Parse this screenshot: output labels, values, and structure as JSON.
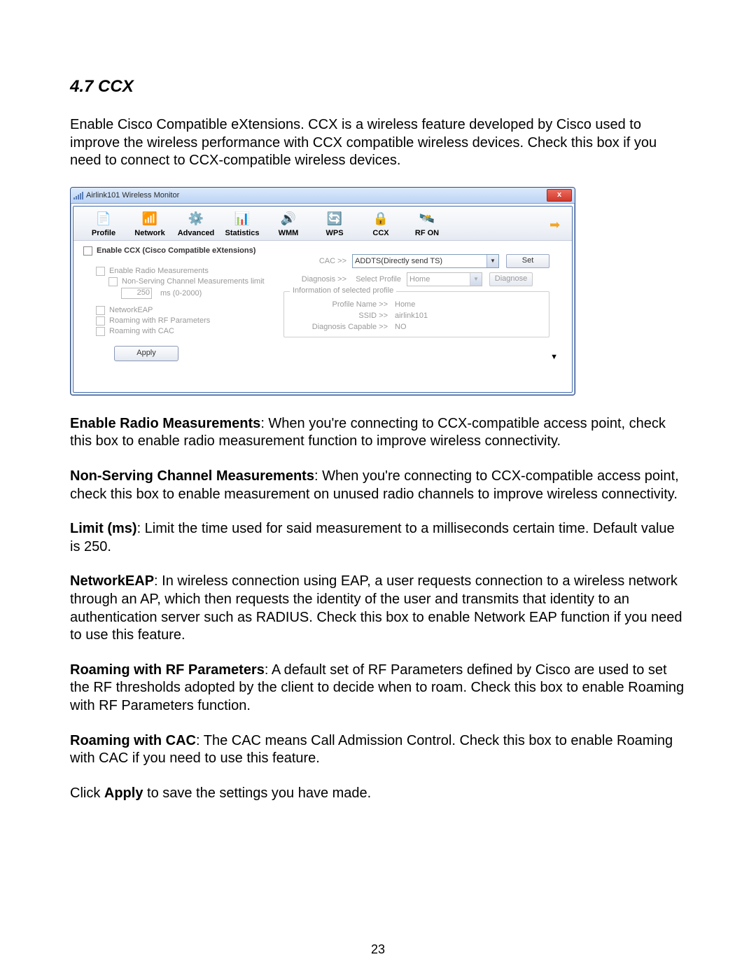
{
  "section": {
    "title": "4.7 CCX"
  },
  "intro": "Enable Cisco Compatible eXtensions. CCX is a wireless feature developed by Cisco used to improve the wireless performance with CCX compatible wireless devices. Check this box if you need to connect to CCX-compatible wireless devices.",
  "window": {
    "title": "Airlink101 Wireless Monitor",
    "close": "x",
    "tabs": {
      "profile": "Profile",
      "network": "Network",
      "advanced": "Advanced",
      "statistics": "Statistics",
      "wmm": "WMM",
      "wps": "WPS",
      "ccx": "CCX",
      "rfon": "RF ON"
    },
    "enable_ccx": "Enable CCX (Cisco Compatible eXtensions)",
    "enable_radio": "Enable Radio Measurements",
    "non_serving": "Non-Serving Channel Measurements limit",
    "limit_value": "250",
    "limit_unit": "ms (0-2000)",
    "networkeap": "NetworkEAP",
    "roaming_rf": "Roaming with RF Parameters",
    "roaming_cac": "Roaming with CAC",
    "apply": "Apply",
    "cac_label": "CAC >>",
    "cac_value": "ADDTS(Directly send TS)",
    "set_btn": "Set",
    "diag_label": "Diagnosis >>",
    "diag_profile_label": "Select Profile",
    "diag_profile_value": "Home",
    "diagnose_btn": "Diagnose",
    "fieldset_title": "Information of selected profile",
    "info": {
      "profile_name_k": "Profile Name >>",
      "profile_name_v": "Home",
      "ssid_k": "SSID >>",
      "ssid_v": "airlink101",
      "diagcap_k": "Diagnosis Capable >>",
      "diagcap_v": "NO"
    }
  },
  "desc": {
    "radio_b": "Enable Radio Measurements",
    "radio_t": ": When you're connecting to CCX-compatible access point, check this box to enable radio measurement function to improve wireless connectivity.",
    "nonserv_b": "Non-Serving Channel Measurements",
    "nonserv_t": ": When you're connecting to CCX-compatible access point, check this box to enable measurement on unused radio channels to improve wireless connectivity.",
    "limit_b": "Limit (ms)",
    "limit_t": ": Limit the time used for said measurement to a milliseconds certain time. Default value is 250.",
    "neap_b": "NetworkEAP",
    "neap_t": ": In wireless connection using EAP, a user requests connection to a wireless network through an AP, which then requests the identity of the user and transmits that identity to an authentication server such as RADIUS. Check this box to enable Network EAP function if you need to use this feature.",
    "roamrf_b": "Roaming with RF Parameters",
    "roamrf_t": ": A default set of RF Parameters defined by Cisco are used to set the RF thresholds adopted by the client to decide when to roam. Check this box to enable Roaming with RF Parameters function.",
    "roamcac_b": "Roaming with CAC",
    "roamcac_t": ": The CAC means Call Admission Control. Check this box to enable Roaming with CAC if you need to use this feature.",
    "apply_pre": "Click ",
    "apply_b": "Apply",
    "apply_post": " to save the settings you have made."
  },
  "page_number": "23"
}
